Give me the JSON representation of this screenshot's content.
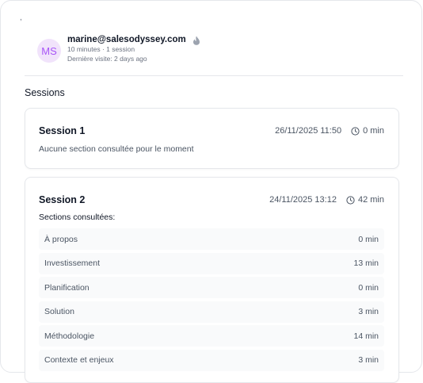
{
  "header": {
    "mark": ",",
    "avatar_initials": "MS",
    "email": "marine@salesodyssey.com",
    "summary": "10 minutes · 1 session",
    "last_visit": "Dernière visite: 2 days ago",
    "flame_icon": "flame-icon"
  },
  "sessions_title": "Sessions",
  "sessions": [
    {
      "title": "Session 1",
      "datetime": "26/11/2025 11:50",
      "duration": "0 min",
      "empty_text": "Aucune section consultée pour le moment"
    },
    {
      "title": "Session 2",
      "datetime": "24/11/2025 13:12",
      "duration": "42 min",
      "sections_label": "Sections consultées:",
      "sections": [
        {
          "name": "À propos",
          "time": "0 min"
        },
        {
          "name": "Investissement",
          "time": "13 min"
        },
        {
          "name": "Planification",
          "time": "0 min"
        },
        {
          "name": "Solution",
          "time": "3 min"
        },
        {
          "name": "Méthodologie",
          "time": "14 min"
        },
        {
          "name": "Contexte et enjeux",
          "time": "3 min"
        }
      ]
    }
  ],
  "colors": {
    "avatar_bg": "#f1e3fb",
    "avatar_text": "#a855f7",
    "border": "#e5e7eb",
    "row_bg": "#f9fafb"
  }
}
